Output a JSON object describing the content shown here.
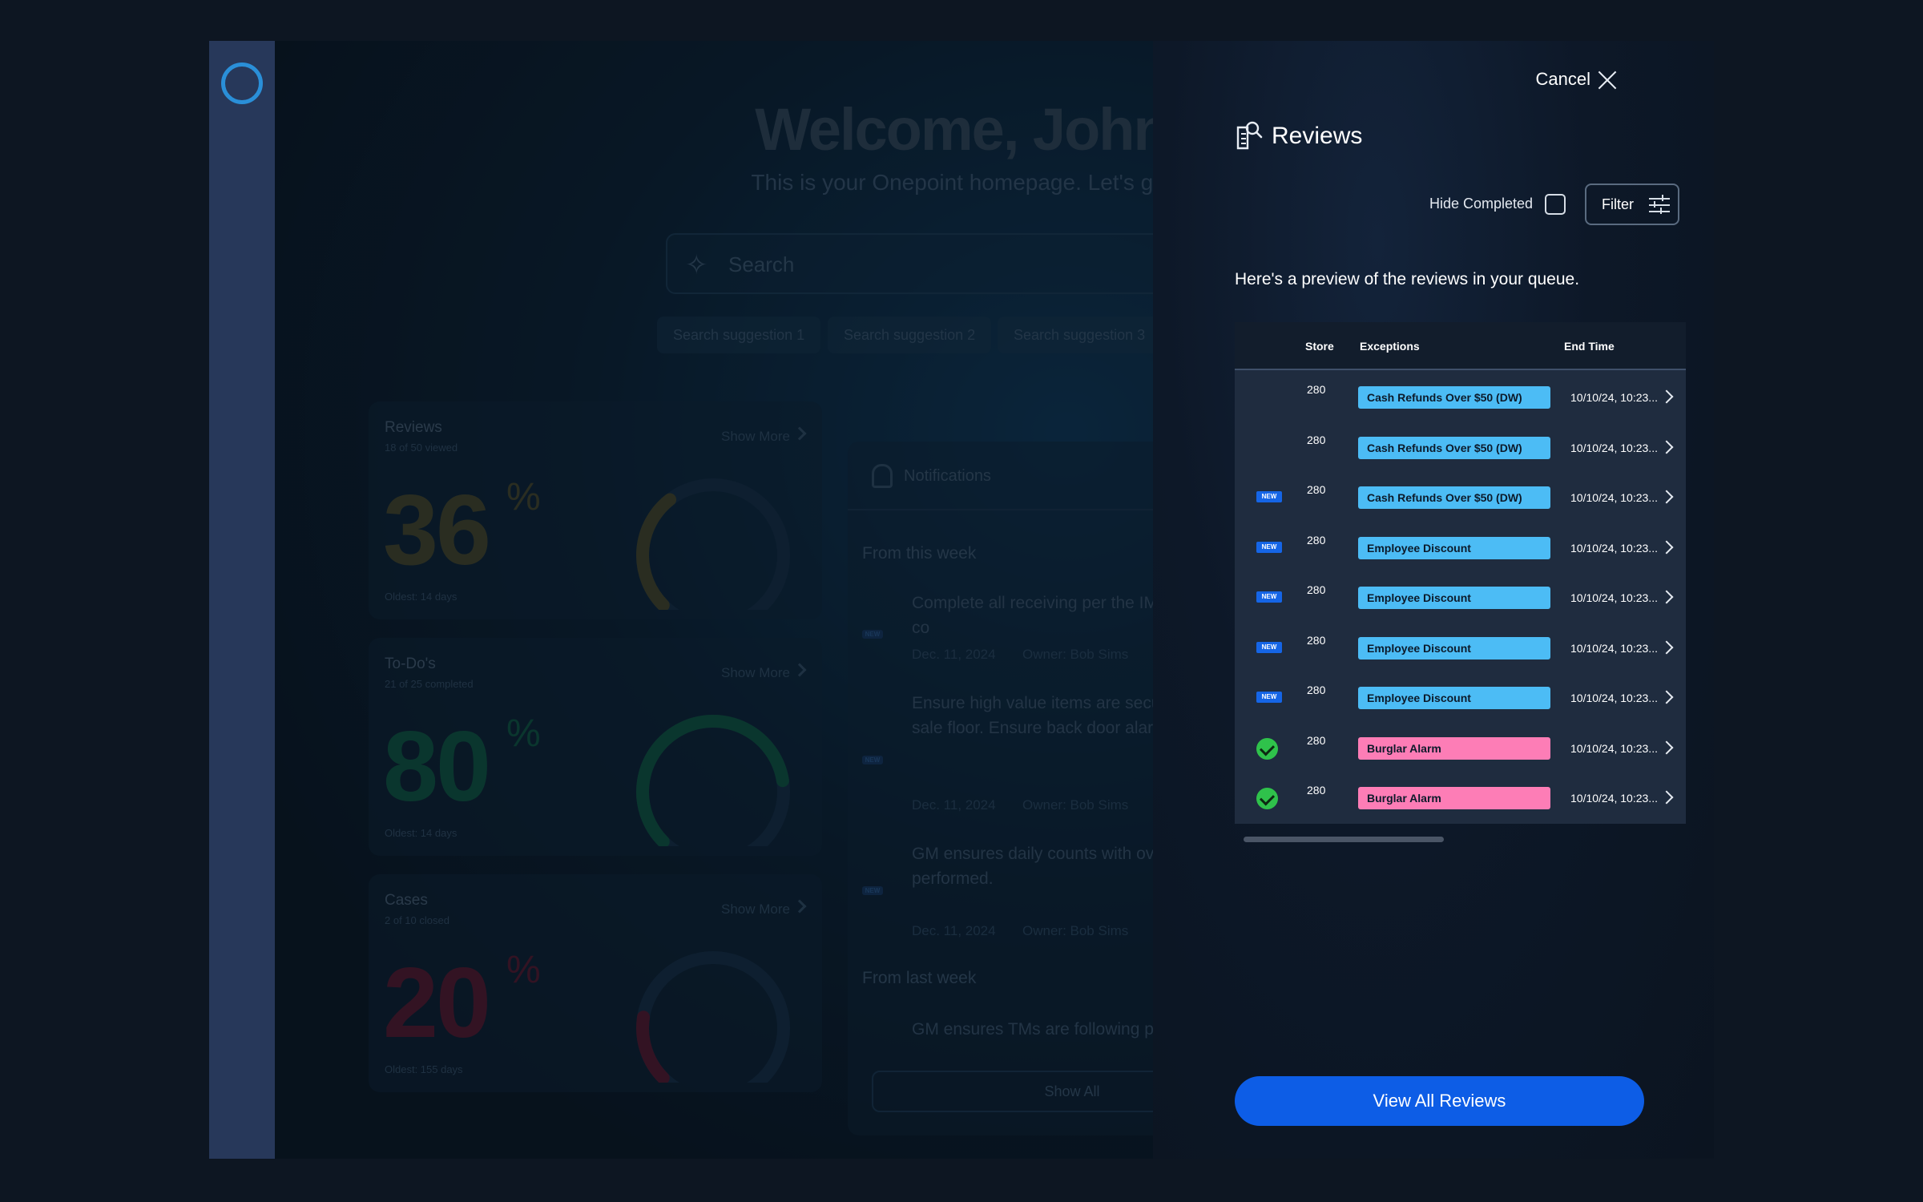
{
  "background": {
    "welcome": "Welcome, John",
    "tagline": "This is your Onepoint homepage. Let's get",
    "search_placeholder": "Search",
    "suggestions": [
      "Search suggestion 1",
      "Search suggestion 2",
      "Search suggestion 3"
    ],
    "cards": [
      {
        "title": "Reviews",
        "sub": "18 of 50 viewed",
        "more": "Show More",
        "pct": "36",
        "sym": "%",
        "oldest": "Oldest: 14 days",
        "color": "#4a4a2e",
        "progress": 0.36
      },
      {
        "title": "To-Do's",
        "sub": "21 of 25 completed",
        "more": "Show More",
        "pct": "80",
        "sym": "%",
        "oldest": "Oldest: 14 days",
        "color": "#0f5a45",
        "progress": 0.8
      },
      {
        "title": "Cases",
        "sub": "2 of 10 closed",
        "more": "Show More",
        "pct": "20",
        "sym": "%",
        "oldest": "Oldest: 155 days",
        "color": "#5a1a32",
        "progress": 0.2
      }
    ],
    "notifications": {
      "title": "Notifications",
      "this_week": "From this week",
      "last_week": "From last week",
      "items": [
        {
          "text": "Complete all receiving per the IM guidebook before starting the co",
          "date": "Dec. 11, 2024",
          "owner": "Owner: Bob Sims"
        },
        {
          "text": "Ensure high value items are secu and backstock is not on the sale floor. Ensure back door alarms a armed.",
          "date": "Dec. 11, 2024",
          "owner": "Owner: Bob Sims"
        },
        {
          "text": "GM ensures daily counts with ov short investigation has been performed.",
          "date": "Dec. 11, 2024",
          "owner": "Owner: Bob Sims"
        },
        {
          "text": "GM ensures TMs are following proper trash procedures. GM wil",
          "date": "",
          "owner": ""
        }
      ],
      "new_badge": "NEW",
      "show_all": "Show All"
    }
  },
  "drawer": {
    "cancel": "Cancel",
    "title": "Reviews",
    "hide_completed": "Hide Completed",
    "filter": "Filter",
    "preview_text": "Here's a preview of the reviews in your queue.",
    "columns": {
      "store": "Store",
      "exceptions": "Exceptions",
      "end_time": "End Time"
    },
    "rows": [
      {
        "status": "none",
        "store": "280",
        "exception": "Cash Refunds Over $50 (DW)",
        "color": "blue",
        "end": "10/10/24, 10:23..."
      },
      {
        "status": "none",
        "store": "280",
        "exception": "Cash Refunds Over $50 (DW)",
        "color": "blue",
        "end": "10/10/24, 10:23..."
      },
      {
        "status": "new",
        "store": "280",
        "exception": "Cash Refunds Over $50 (DW)",
        "color": "blue",
        "end": "10/10/24, 10:23..."
      },
      {
        "status": "new",
        "store": "280",
        "exception": "Employee Discount",
        "color": "blue",
        "end": "10/10/24, 10:23..."
      },
      {
        "status": "new",
        "store": "280",
        "exception": "Employee Discount",
        "color": "blue",
        "end": "10/10/24, 10:23..."
      },
      {
        "status": "new",
        "store": "280",
        "exception": "Employee Discount",
        "color": "blue",
        "end": "10/10/24, 10:23..."
      },
      {
        "status": "new",
        "store": "280",
        "exception": "Employee Discount",
        "color": "blue",
        "end": "10/10/24, 10:23..."
      },
      {
        "status": "done",
        "store": "280",
        "exception": "Burglar Alarm",
        "color": "pink",
        "end": "10/10/24, 10:23..."
      },
      {
        "status": "done",
        "store": "280",
        "exception": "Burglar Alarm",
        "color": "pink",
        "end": "10/10/24, 10:23..."
      }
    ],
    "new_badge": "NEW",
    "view_all": "View All Reviews"
  },
  "colors": {
    "accent": "#0d5de6",
    "pill_blue": "#4cbcf5",
    "pill_pink": "#fd7db6",
    "check_green": "#2fc24b"
  },
  "icons": {
    "cancel": "close-icon",
    "reviews": "document-search-icon",
    "filter": "sliders-icon",
    "row": "chevron-right-icon"
  }
}
